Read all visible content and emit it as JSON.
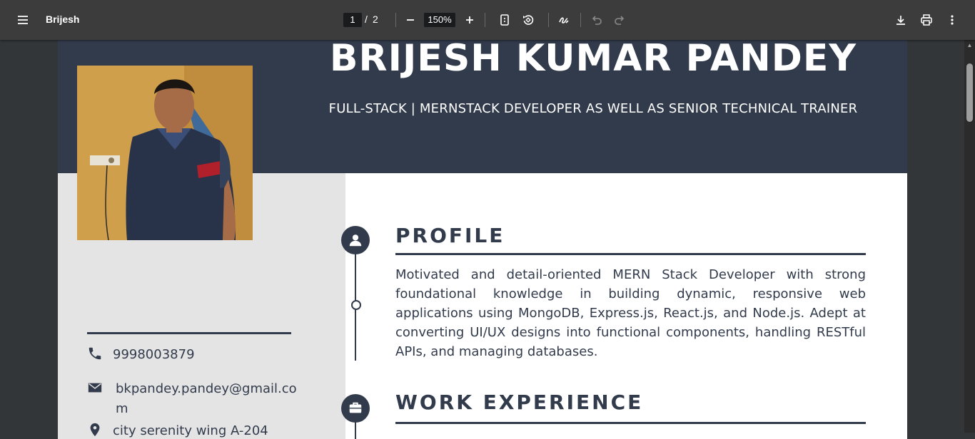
{
  "toolbar": {
    "title": "Brijesh",
    "current_page": "1",
    "page_separator": "/",
    "total_pages": "2",
    "zoom": "150%"
  },
  "resume": {
    "name": "BRIJESH KUMAR PANDEY",
    "subtitle": "FULL-STACK | MERNSTACK DEVELOPER AS WELL AS SENIOR TECHNICAL TRAINER",
    "contact": {
      "phone": "9998003879",
      "email_line1": "bkpandey.pandey@gmail.co",
      "email_line2": "m",
      "address": "city serenity wing A-204"
    },
    "profile": {
      "heading": "PROFILE",
      "text": "Motivated and detail-oriented MERN Stack Developer with strong foundational knowledge in building dynamic, responsive web applications using MongoDB, Express.js, React.js, and Node.js. Adept at converting UI/UX designs into functional components, handling RESTful APIs, and managing databases."
    },
    "work": {
      "heading": "WORK EXPERIENCE"
    }
  },
  "colors": {
    "toolbar": "#3c3c3c",
    "viewer_bg": "#323639",
    "resume_dark": "#323b4c",
    "sidebar": "#e4e4e4"
  }
}
